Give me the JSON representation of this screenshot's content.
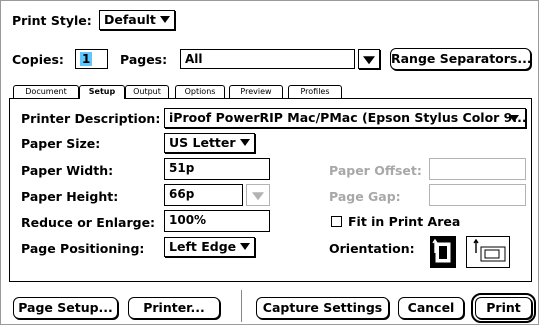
{
  "print_style": {
    "label": "Print Style:",
    "value": "Default"
  },
  "copies": {
    "label": "Copies:",
    "value": "1"
  },
  "pages": {
    "label": "Pages:",
    "value": "All"
  },
  "range_separators_button": "Range Separators...",
  "tabs": [
    "Document",
    "Setup",
    "Output",
    "Options",
    "Preview",
    "Profiles"
  ],
  "active_tab": "Setup",
  "setup": {
    "printer_description": {
      "label": "Printer Description:",
      "value": "iProof PowerRIP Mac/PMac (Epson Stylus Color 9..."
    },
    "paper_size": {
      "label": "Paper Size:",
      "value": "US Letter"
    },
    "paper_width": {
      "label": "Paper Width:",
      "value": "51p"
    },
    "paper_height": {
      "label": "Paper Height:",
      "value": "66p"
    },
    "paper_offset": {
      "label": "Paper Offset:",
      "value": ""
    },
    "page_gap": {
      "label": "Page Gap:",
      "value": ""
    },
    "reduce_enlarge": {
      "label": "Reduce or Enlarge:",
      "value": "100%"
    },
    "fit_in_print_area": {
      "label": "Fit in Print Area",
      "checked": false
    },
    "page_positioning": {
      "label": "Page Positioning:",
      "value": "Left Edge"
    },
    "orientation": {
      "label": "Orientation:",
      "selected": "portrait"
    }
  },
  "buttons": {
    "page_setup": "Page Setup...",
    "printer": "Printer...",
    "capture_settings": "Capture Settings",
    "cancel": "Cancel",
    "print": "Print"
  }
}
